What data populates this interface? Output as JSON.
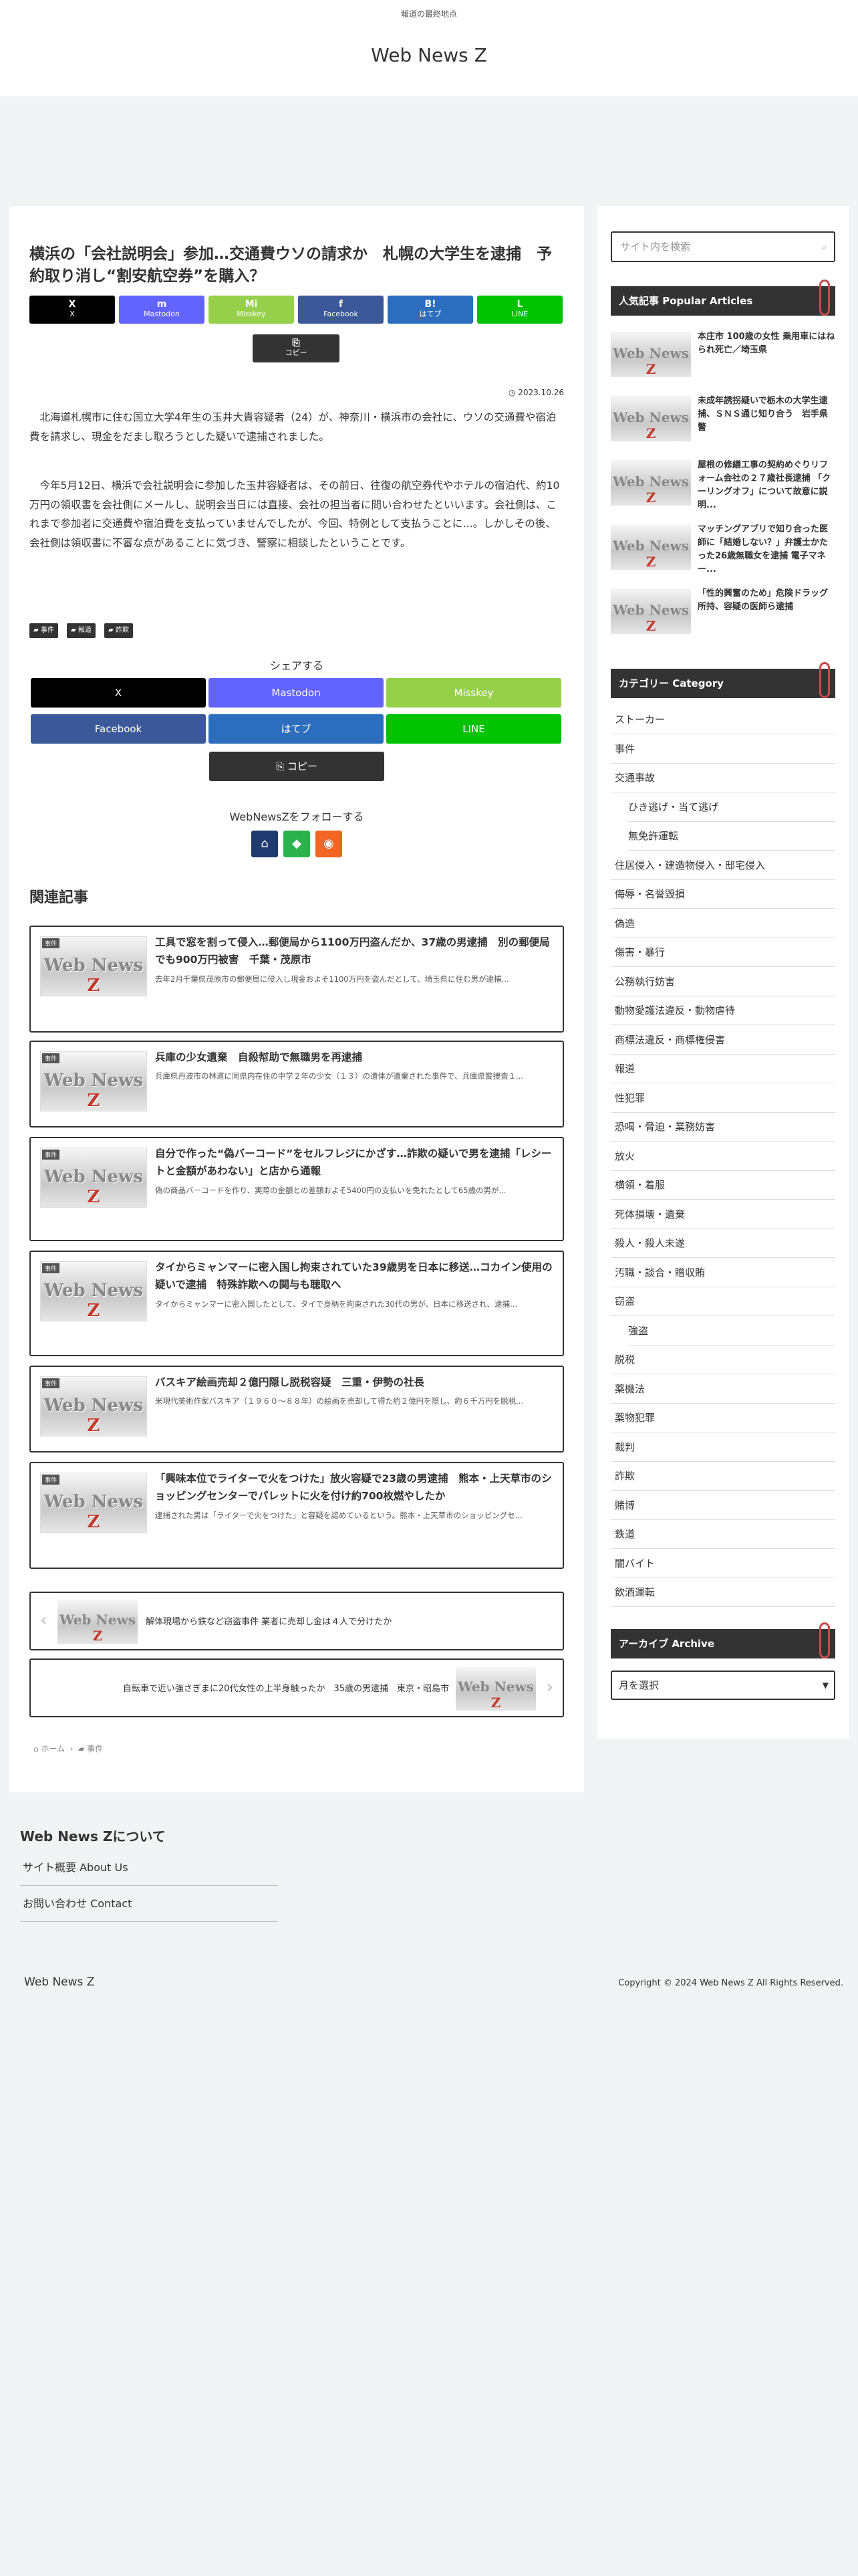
{
  "header": {
    "tagline": "報道の最終地点",
    "site_title": "Web News Z"
  },
  "article": {
    "title": "横浜の「会社説明会」参加…交通費ウソの請求か　札幌の大学生を逮捕　予約取り消し“割安航空券”を購入？",
    "date": "2023.10.26",
    "paragraphs": [
      "北海道札幌市に住む国立大学4年生の玉井大貴容疑者（24）が、神奈川・横浜市の会社に、ウソの交通費や宿泊費を請求し、現金をだまし取ろうとした疑いで逮捕されました。",
      "今年5月12日、横浜で会社説明会に参加した玉井容疑者は、その前日、往復の航空券代やホテルの宿泊代、約10万円の領収書を会社側にメールし、説明会当日には直接、会社の担当者に問い合わせたといいます。会社側は、これまで参加者に交通費や宿泊費を支払っていませんでしたが、今回、特例として支払うことに…。しかしその後、会社側は領収書に不審な点があることに気づき、警察に相談したということです。"
    ],
    "tags": [
      "事件",
      "報道",
      "詐欺"
    ]
  },
  "share_top": [
    {
      "icon": "X",
      "label": "X",
      "color": "#000000"
    },
    {
      "icon": "m",
      "label": "Mastodon",
      "color": "#6364ff"
    },
    {
      "icon": "Mi",
      "label": "Misskey",
      "color": "#96d04a"
    },
    {
      "icon": "f",
      "label": "Facebook",
      "color": "#3b5998"
    },
    {
      "icon": "B!",
      "label": "はてブ",
      "color": "#2c6ebd"
    },
    {
      "icon": "L",
      "label": "LINE",
      "color": "#00c300"
    }
  ],
  "copy_label": "コピー",
  "share_bottom": {
    "heading": "シェアする",
    "buttons": [
      {
        "label": "X",
        "color": "#000000"
      },
      {
        "label": "Mastodon",
        "color": "#6364ff"
      },
      {
        "label": "Misskey",
        "color": "#96d04a"
      },
      {
        "label": "Facebook",
        "color": "#3b5998"
      },
      {
        "label": "はてブ",
        "color": "#2c6ebd"
      },
      {
        "label": "LINE",
        "color": "#00c300"
      }
    ],
    "copy": "コピー"
  },
  "follow": {
    "heading": "WebNewsZをフォローする"
  },
  "related": {
    "heading": "関連記事",
    "items": [
      {
        "cat": "事件",
        "title": "工具で窓を割って侵入…郵便局から1100万円盗んだか、37歳の男逮捕　別の郵便局でも900万円被害　千葉・茂原市",
        "snippet": "去年2月千葉県茂原市の郵便局に侵入し現金およそ1100万円を盗んだとして、埼玉県に住む男が逮捕..."
      },
      {
        "cat": "事件",
        "title": "兵庫の少女遺棄　自殺幇助で無職男を再逮捕",
        "snippet": "兵庫県丹波市の林道に同県内在住の中学２年の少女（１３）の遺体が遺棄された事件で、兵庫県警捜査１..."
      },
      {
        "cat": "事件",
        "title": "自分で作った“偽バーコード”をセルフレジにかざす…詐欺の疑いで男を逮捕「レシートと金額があわない」と店から通報",
        "snippet": "偽の商品バーコードを作り、実際の金額との差額およそ5400円の支払いを免れたとして65歳の男が..."
      },
      {
        "cat": "事件",
        "title": "タイからミャンマーに密入国し拘束されていた39歳男を日本に移送…コカイン使用の疑いで逮捕　特殊詐欺への関与も聴取へ",
        "snippet": "タイからミャンマーに密入国したとして、タイで身柄を拘束された30代の男が、日本に移送され、逮捕..."
      },
      {
        "cat": "事件",
        "title": "バスキア絵画売却２億円隠し脱税容疑　三重・伊勢の社長",
        "snippet": "米現代美術作家バスキア（１９６０～８８年）の絵画を売却して得た約２億円を隠し、約６千万円を脱税..."
      },
      {
        "cat": "事件",
        "title": "「興味本位でライターで火をつけた」放火容疑で23歳の男逮捕　熊本・上天草市のショッピングセンターでパレットに火を付け約700枚燃やしたか",
        "snippet": "逮捕された男は「ライターで火をつけた」と容疑を認めているという。熊本・上天草市のショッピングセ..."
      }
    ]
  },
  "prev_next": {
    "prev": "解体現場から鉄など窃盗事件 業者に売却し金は４人で分けたか",
    "next": "自転車で近い強さぎまに20代女性の上半身触ったか　35歳の男逮捕　東京・昭島市"
  },
  "breadcrumb": {
    "home": "ホーム",
    "cat": "事件"
  },
  "sidebar": {
    "search_placeholder": "サイト内を検索",
    "popular": {
      "heading": "人気記事 Popular Articles",
      "items": [
        "本庄市 100歳の女性 乗用車にはねられ死亡／埼玉県",
        "未成年誘拐疑いで栃木の大学生逮捕、ＳＮＳ通じ知り合う　岩手県警",
        "屋根の修繕工事の契約めぐりリフォーム会社の２７歳社長逮捕 「クーリングオフ」について故意に説明...",
        "マッチングアプリで知り合った医師に「結婚しない？」弁護士かたった26歳無職女を逮捕 電子マネー...",
        "「性的興奮のため」危険ドラッグ所持、容疑の医師ら逮捕"
      ]
    },
    "category": {
      "heading": "カテゴリー Category",
      "items": [
        {
          "label": "ストーカー",
          "sub": false
        },
        {
          "label": "事件",
          "sub": false
        },
        {
          "label": "交通事故",
          "sub": false
        },
        {
          "label": "ひき逃げ・当て逃げ",
          "sub": true
        },
        {
          "label": "無免許運転",
          "sub": true
        },
        {
          "label": "住居侵入・建造物侵入・邸宅侵入",
          "sub": false
        },
        {
          "label": "侮辱・名誉毀損",
          "sub": false
        },
        {
          "label": "偽造",
          "sub": false
        },
        {
          "label": "傷害・暴行",
          "sub": false
        },
        {
          "label": "公務執行妨害",
          "sub": false
        },
        {
          "label": "動物愛護法違反・動物虐待",
          "sub": false
        },
        {
          "label": "商標法違反・商標権侵害",
          "sub": false
        },
        {
          "label": "報道",
          "sub": false
        },
        {
          "label": "性犯罪",
          "sub": false
        },
        {
          "label": "恐喝・脅迫・業務妨害",
          "sub": false
        },
        {
          "label": "放火",
          "sub": false
        },
        {
          "label": "横領・着服",
          "sub": false
        },
        {
          "label": "死体損壊・遺棄",
          "sub": false
        },
        {
          "label": "殺人・殺人未遂",
          "sub": false
        },
        {
          "label": "汚職・談合・贈収賄",
          "sub": false
        },
        {
          "label": "窃盗",
          "sub": false
        },
        {
          "label": "強盗",
          "sub": true
        },
        {
          "label": "脱税",
          "sub": false
        },
        {
          "label": "薬機法",
          "sub": false
        },
        {
          "label": "薬物犯罪",
          "sub": false
        },
        {
          "label": "裁判",
          "sub": false
        },
        {
          "label": "詐欺",
          "sub": false
        },
        {
          "label": "賭博",
          "sub": false
        },
        {
          "label": "鉄道",
          "sub": false
        },
        {
          "label": "闇バイト",
          "sub": false
        },
        {
          "label": "飲酒運転",
          "sub": false
        }
      ]
    },
    "archive": {
      "heading": "アーカイブ Archive",
      "select": "月を選択"
    }
  },
  "footer": {
    "heading": "Web News Zについて",
    "links": [
      "サイト概要 About Us",
      "お問い合わせ Contact"
    ],
    "brand": "Web News Z",
    "copyright": "Copyright © 2024 Web News Z All Rights Reserved."
  }
}
